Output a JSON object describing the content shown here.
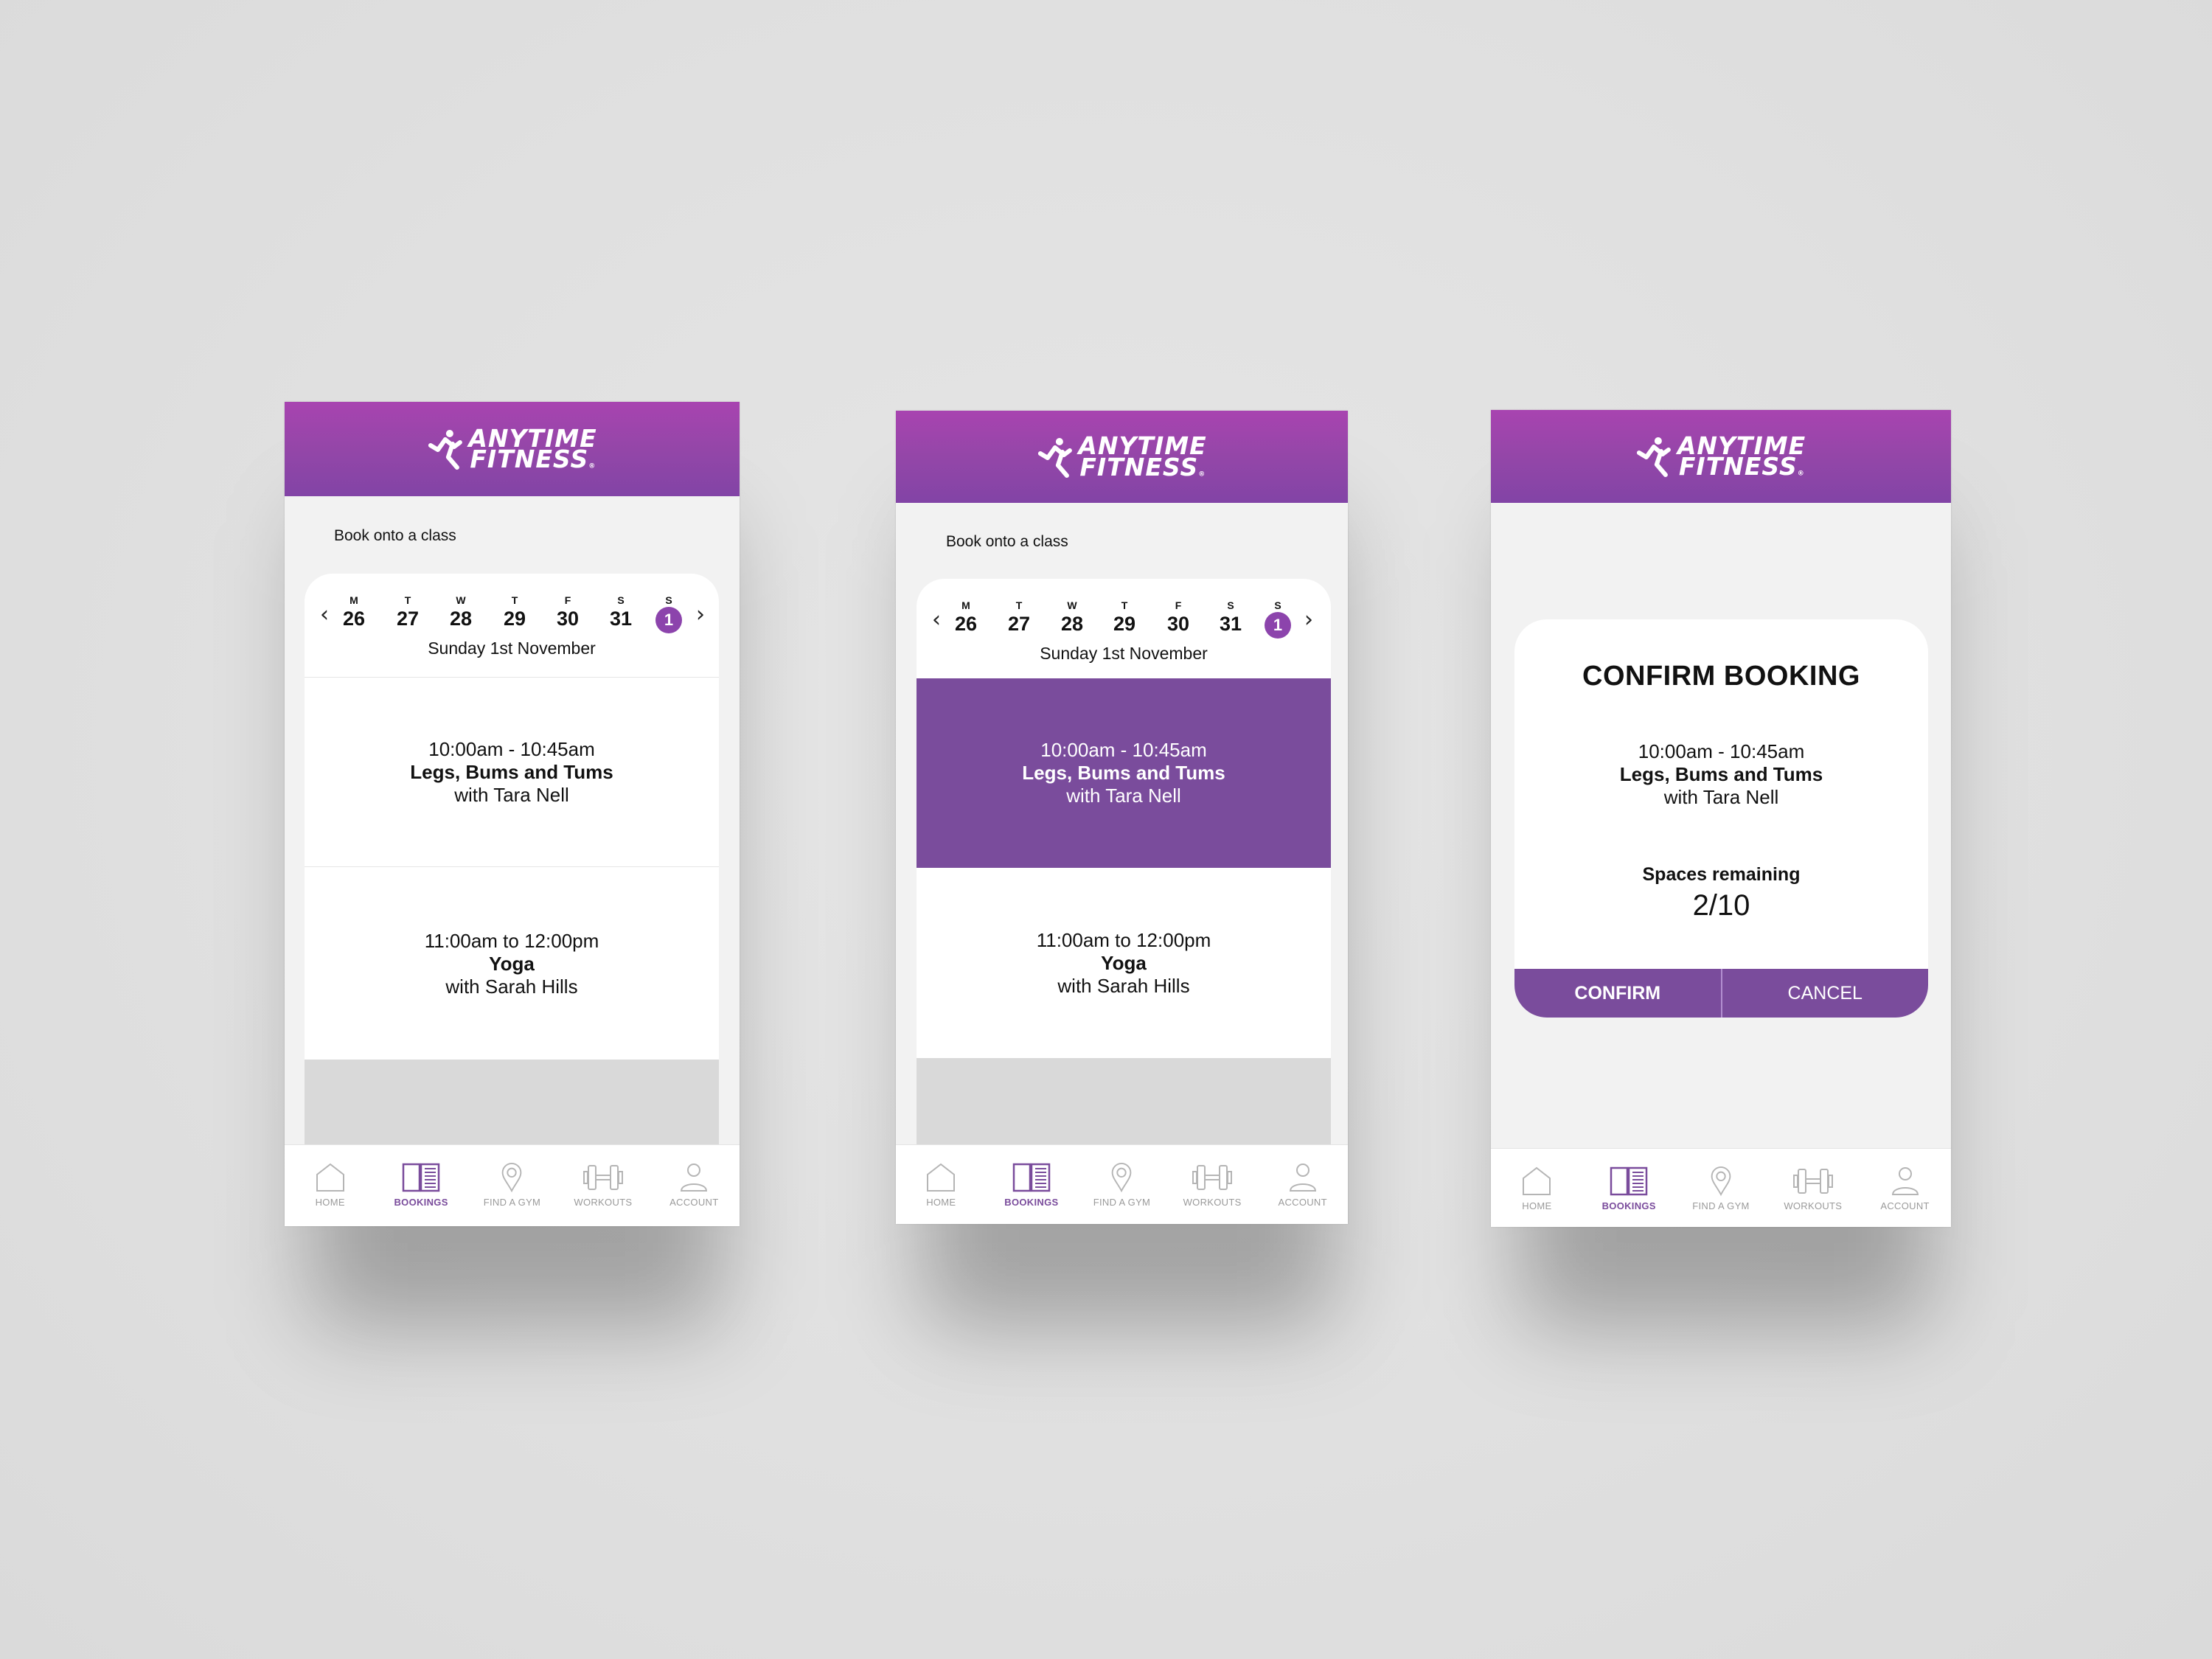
{
  "app": {
    "brand_line1": "ANYTIME",
    "brand_line2": "FITNESS",
    "brand_mark": "®",
    "colors": {
      "header_top": "#a844b0",
      "header_bottom": "#8244a6",
      "accent": "#7a4c9c",
      "selected_day": "#8c44ac",
      "inactive_nav": "#9a9a9a"
    }
  },
  "calendar": {
    "prev_icon": "‹",
    "next_icon": "›",
    "days": [
      {
        "dow": "M",
        "num": "26"
      },
      {
        "dow": "T",
        "num": "27"
      },
      {
        "dow": "W",
        "num": "28"
      },
      {
        "dow": "T",
        "num": "29"
      },
      {
        "dow": "F",
        "num": "30"
      },
      {
        "dow": "S",
        "num": "31"
      },
      {
        "dow": "S",
        "num": "1",
        "selected": true
      }
    ],
    "selected_label": "Sunday 1st November"
  },
  "screens": [
    {
      "title": "Book onto a class",
      "classes": [
        {
          "time": "10:00am - 10:45am",
          "name": "Legs, Bums and Tums",
          "instructor": "with Tara Nell",
          "selected": false
        },
        {
          "time": "11:00am to 12:00pm",
          "name": "Yoga",
          "instructor": "with Sarah Hills",
          "selected": false
        }
      ]
    },
    {
      "title": "Book onto a class",
      "classes": [
        {
          "time": "10:00am - 10:45am",
          "name": "Legs, Bums and Tums",
          "instructor": "with Tara Nell",
          "selected": true
        },
        {
          "time": "11:00am to 12:00pm",
          "name": "Yoga",
          "instructor": "with Sarah Hills",
          "selected": false
        }
      ]
    },
    {
      "modal": {
        "title": "CONFIRM BOOKING",
        "time": "10:00am - 10:45am",
        "name": "Legs, Bums and Tums",
        "instructor": "with Tara Nell",
        "spaces_label": "Spaces remaining",
        "spaces_value": "2/10",
        "spaces_remaining": 2,
        "spaces_total": 10,
        "confirm_label": "CONFIRM",
        "cancel_label": "CANCEL"
      }
    }
  ],
  "nav": {
    "items": [
      {
        "label": "HOME",
        "icon": "home-icon",
        "active": false
      },
      {
        "label": "BOOKINGS",
        "icon": "bookings-icon",
        "active": true
      },
      {
        "label": "FIND A GYM",
        "icon": "location-pin-icon",
        "active": false
      },
      {
        "label": "WORKOUTS",
        "icon": "dumbbell-icon",
        "active": false
      },
      {
        "label": "ACCOUNT",
        "icon": "account-icon",
        "active": false
      }
    ]
  }
}
